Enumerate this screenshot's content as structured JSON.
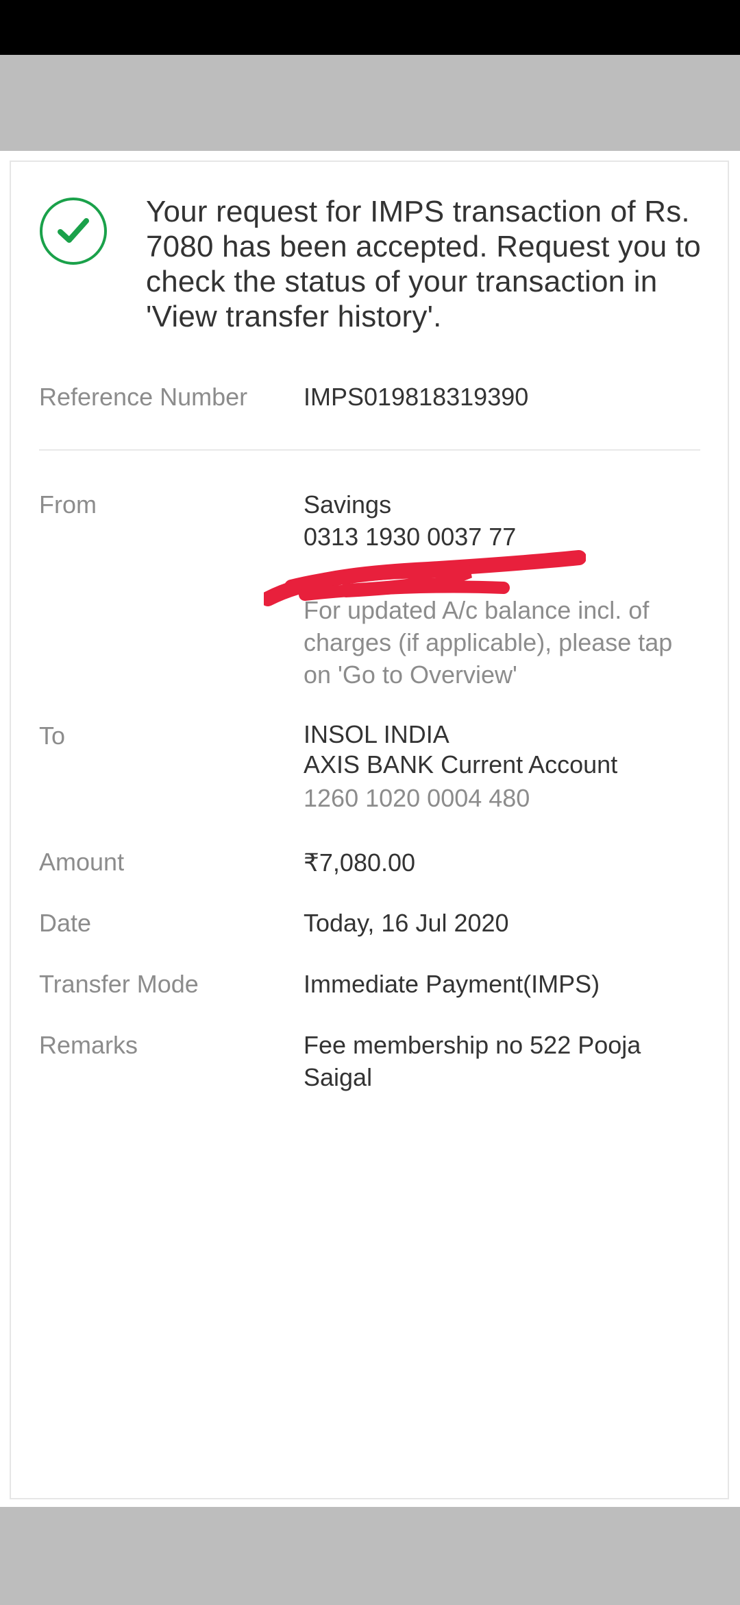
{
  "message": "Your request for IMPS transaction of Rs. 7080 has been accepted. Request you to check the status of your transaction in 'View transfer history'.",
  "reference": {
    "label": "Reference Number",
    "value": "IMPS019818319390"
  },
  "from": {
    "label": "From",
    "account_type": "Savings",
    "account_number": "0313 1930 0037 77",
    "note": "For updated A/c balance incl. of charges (if applicable), please tap on 'Go to Overview'"
  },
  "to": {
    "label": "To",
    "name": "INSOL INDIA",
    "bank": "AXIS BANK Current Account",
    "account_number": "1260 1020 0004 480"
  },
  "amount": {
    "label": "Amount",
    "value": "₹7,080.00"
  },
  "date": {
    "label": "Date",
    "value": "Today, 16 Jul 2020"
  },
  "mode": {
    "label": "Transfer Mode",
    "value": "Immediate Payment(IMPS)"
  },
  "remarks": {
    "label": "Remarks",
    "value": "Fee membership no 522 Pooja Saigal"
  },
  "icons": {
    "success": "check-circle-icon"
  },
  "colors": {
    "success": "#1aa14a",
    "redaction": "#e8203c"
  }
}
